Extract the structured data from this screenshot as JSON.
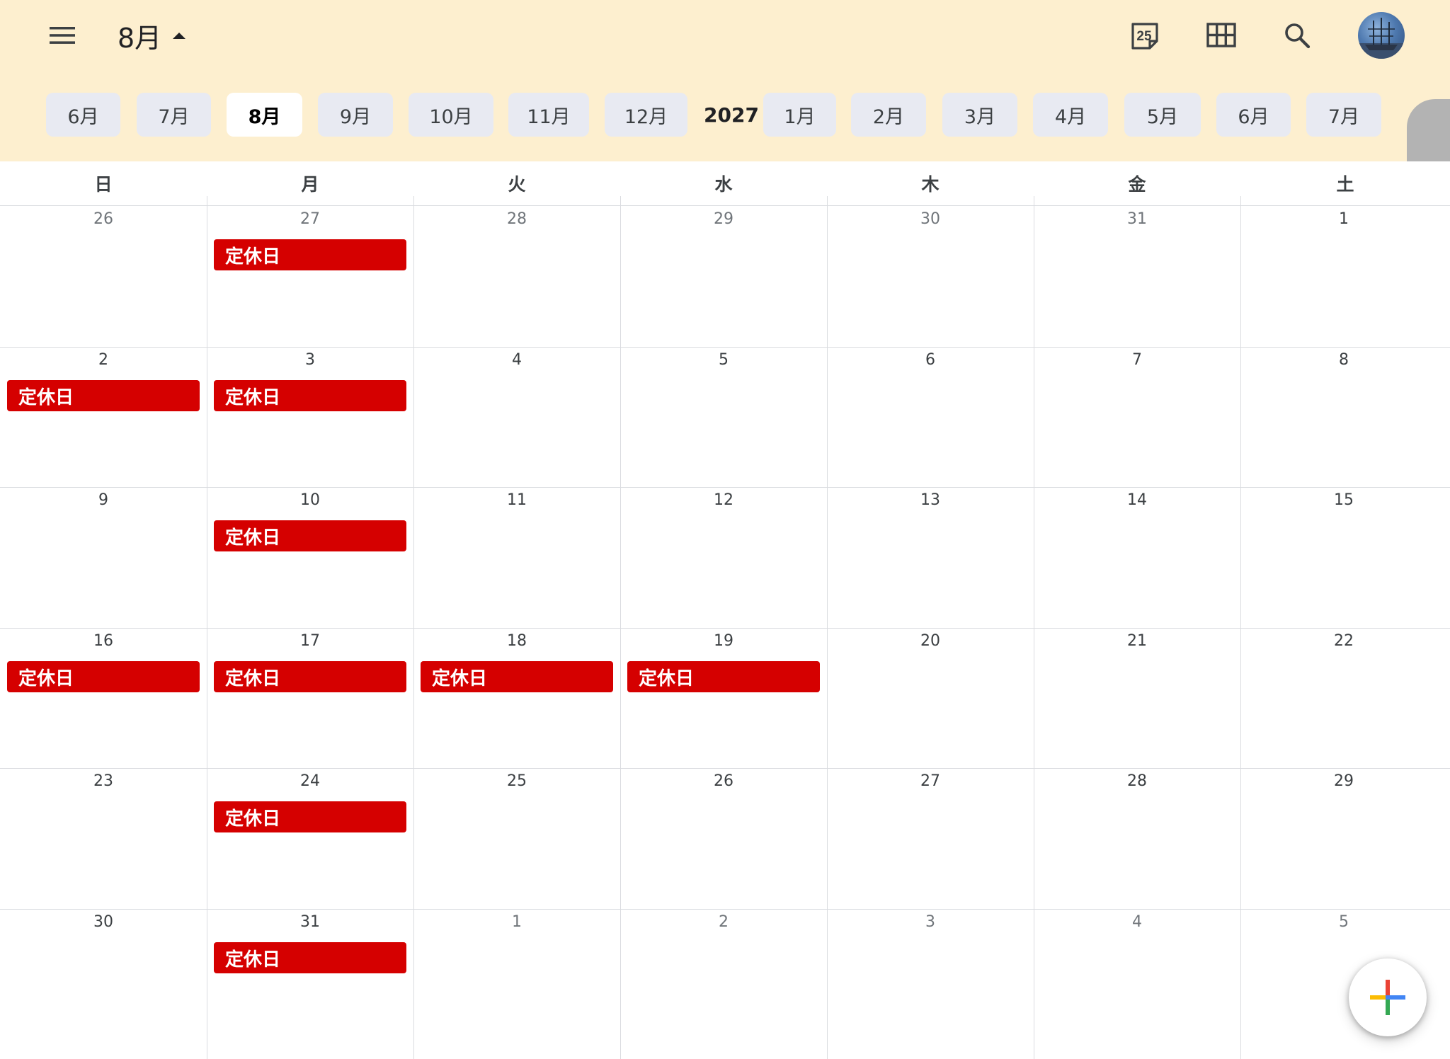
{
  "header": {
    "title": "8月",
    "today_date": "25"
  },
  "month_strip": {
    "months_before": [
      "6月",
      "7月",
      "8月",
      "9月",
      "10月",
      "11月",
      "12月"
    ],
    "year": "2027",
    "months_after": [
      "1月",
      "2月",
      "3月",
      "4月",
      "5月",
      "6月",
      "7月"
    ],
    "selected": "8月"
  },
  "weekdays": [
    "日",
    "月",
    "火",
    "水",
    "木",
    "金",
    "土"
  ],
  "weeks": [
    [
      {
        "day": "26",
        "muted": true
      },
      {
        "day": "27",
        "muted": true,
        "event": "定休日"
      },
      {
        "day": "28",
        "muted": true
      },
      {
        "day": "29",
        "muted": true
      },
      {
        "day": "30",
        "muted": true
      },
      {
        "day": "31",
        "muted": true
      },
      {
        "day": "1"
      }
    ],
    [
      {
        "day": "2",
        "event": "定休日"
      },
      {
        "day": "3",
        "event": "定休日"
      },
      {
        "day": "4"
      },
      {
        "day": "5"
      },
      {
        "day": "6"
      },
      {
        "day": "7"
      },
      {
        "day": "8"
      }
    ],
    [
      {
        "day": "9"
      },
      {
        "day": "10",
        "event": "定休日"
      },
      {
        "day": "11"
      },
      {
        "day": "12"
      },
      {
        "day": "13"
      },
      {
        "day": "14"
      },
      {
        "day": "15"
      }
    ],
    [
      {
        "day": "16",
        "event": "定休日"
      },
      {
        "day": "17",
        "event": "定休日"
      },
      {
        "day": "18",
        "event": "定休日"
      },
      {
        "day": "19",
        "event": "定休日"
      },
      {
        "day": "20"
      },
      {
        "day": "21"
      },
      {
        "day": "22"
      }
    ],
    [
      {
        "day": "23"
      },
      {
        "day": "24",
        "event": "定休日"
      },
      {
        "day": "25"
      },
      {
        "day": "26"
      },
      {
        "day": "27"
      },
      {
        "day": "28"
      },
      {
        "day": "29"
      }
    ],
    [
      {
        "day": "30"
      },
      {
        "day": "31",
        "event": "定休日"
      },
      {
        "day": "1",
        "muted": true
      },
      {
        "day": "2",
        "muted": true
      },
      {
        "day": "3",
        "muted": true
      },
      {
        "day": "4",
        "muted": true
      },
      {
        "day": "5",
        "muted": true
      }
    ]
  ],
  "icons": {
    "menu": "hamburger-menu-icon",
    "title_toggle": "arrow-up-icon",
    "today": "calendar-today-icon",
    "view": "grid-view-icon",
    "search": "search-icon",
    "fab": "plus-icon"
  },
  "colors": {
    "header_bg": "#fdefcf",
    "chip_bg": "#e8eaf2",
    "event_bg": "#d50000",
    "fab_red": "#ea4335",
    "fab_blue": "#4285f4",
    "fab_yellow": "#fbbc04",
    "fab_green": "#34a853"
  }
}
